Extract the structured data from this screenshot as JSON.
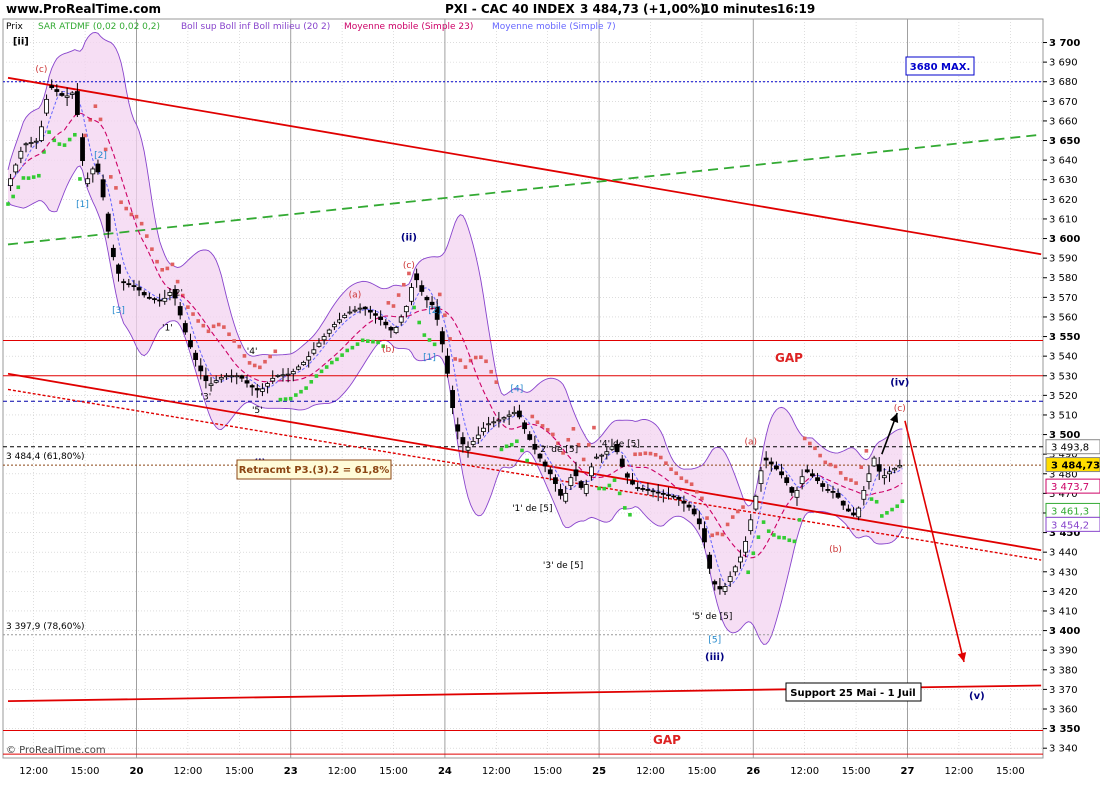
{
  "header": {
    "site": "www.ProRealTime.com",
    "instrument": "PXI - CAC 40 INDEX",
    "quote": "3 484,73 (+1,00%)",
    "interval": "10 minutes",
    "time": "16:19"
  },
  "legend": {
    "price": "Prix",
    "sar": "SAR ATDMF (0,02 0,02 0,2)",
    "boll": "Boll sup Boll inf Boll milieu (20 2)",
    "ma23": "Moyenne mobile (Simple 23)",
    "ma7": "Moyenne mobile (Simple 7)"
  },
  "colors": {
    "price": "#000000",
    "sar_up": "#33cc33",
    "sar_down": "#e06060",
    "boll": "#8844cc",
    "boll_fill": "#f3d3f0",
    "ma23": "#cc0066",
    "ma7": "#6666ff",
    "trend": "#e00000",
    "green_line": "#33aa33",
    "navy": "#000080",
    "grid": "#c8c8c8"
  },
  "footer": {
    "copyright": "© ProRealTime.com"
  },
  "chart_data": {
    "type": "candlestick",
    "ylim": [
      3335,
      3712
    ],
    "y_ticks": [
      "3 700",
      "3 690",
      "3 680",
      "3 670",
      "3 660",
      "3 650",
      "3 640",
      "3 630",
      "3 620",
      "3 610",
      "3 600",
      "3 590",
      "3 580",
      "3 570",
      "3 560",
      "3 550",
      "3 540",
      "3 530",
      "3 520",
      "3 510",
      "3 500",
      "3 490",
      "3 480",
      "3 470",
      "3 460",
      "3 450",
      "3 440",
      "3 430",
      "3 420",
      "3 410",
      "3 400",
      "3 390",
      "3 380",
      "3 370",
      "3 360",
      "3 350",
      "3 340"
    ],
    "y_tick_values": [
      3700,
      3690,
      3680,
      3670,
      3660,
      3650,
      3640,
      3630,
      3620,
      3610,
      3600,
      3590,
      3580,
      3570,
      3560,
      3550,
      3540,
      3530,
      3520,
      3510,
      3500,
      3490,
      3480,
      3470,
      3460,
      3450,
      3440,
      3430,
      3420,
      3410,
      3400,
      3390,
      3380,
      3370,
      3360,
      3350,
      3340
    ],
    "x_ticks": [
      {
        "label": "12:00",
        "t": 0.5,
        "bold": false
      },
      {
        "label": "15:00",
        "t": 1.5,
        "bold": false
      },
      {
        "label": "20",
        "t": 2.5,
        "bold": true
      },
      {
        "label": "12:00",
        "t": 3.5,
        "bold": false
      },
      {
        "label": "15:00",
        "t": 4.5,
        "bold": false
      },
      {
        "label": "23",
        "t": 5.5,
        "bold": true
      },
      {
        "label": "12:00",
        "t": 6.5,
        "bold": false
      },
      {
        "label": "15:00",
        "t": 7.5,
        "bold": false
      },
      {
        "label": "24",
        "t": 8.5,
        "bold": true
      },
      {
        "label": "12:00",
        "t": 9.5,
        "bold": false
      },
      {
        "label": "15:00",
        "t": 10.5,
        "bold": false
      },
      {
        "label": "25",
        "t": 11.5,
        "bold": true
      },
      {
        "label": "12:00",
        "t": 12.5,
        "bold": false
      },
      {
        "label": "15:00",
        "t": 13.5,
        "bold": false
      },
      {
        "label": "26",
        "t": 14.5,
        "bold": true
      },
      {
        "label": "12:00",
        "t": 15.5,
        "bold": false
      },
      {
        "label": "15:00",
        "t": 16.5,
        "bold": false
      },
      {
        "label": "27",
        "t": 17.5,
        "bold": true
      },
      {
        "label": "12:00",
        "t": 18.5,
        "bold": false
      },
      {
        "label": "15:00",
        "t": 19.5,
        "bold": false
      }
    ],
    "price_path": [
      [
        0.0,
        3627
      ],
      [
        0.3,
        3648
      ],
      [
        0.6,
        3650
      ],
      [
        0.8,
        3678
      ],
      [
        1.1,
        3672
      ],
      [
        1.3,
        3675
      ],
      [
        1.5,
        3628
      ],
      [
        1.7,
        3638
      ],
      [
        1.8,
        3630
      ],
      [
        2.0,
        3595
      ],
      [
        2.2,
        3578
      ],
      [
        2.5,
        3575
      ],
      [
        2.7,
        3570
      ],
      [
        3.0,
        3568
      ],
      [
        3.2,
        3574
      ],
      [
        3.5,
        3548
      ],
      [
        3.7,
        3535
      ],
      [
        3.9,
        3525
      ],
      [
        4.2,
        3530
      ],
      [
        4.5,
        3530
      ],
      [
        4.7,
        3525
      ],
      [
        4.9,
        3522
      ],
      [
        5.2,
        3530
      ],
      [
        5.5,
        3531
      ],
      [
        5.8,
        3538
      ],
      [
        6.0,
        3545
      ],
      [
        6.3,
        3555
      ],
      [
        6.6,
        3562
      ],
      [
        6.9,
        3565
      ],
      [
        7.2,
        3560
      ],
      [
        7.5,
        3552
      ],
      [
        7.8,
        3568
      ],
      [
        7.9,
        3582
      ],
      [
        8.1,
        3570
      ],
      [
        8.3,
        3565
      ],
      [
        8.5,
        3540
      ],
      [
        8.7,
        3505
      ],
      [
        8.9,
        3492
      ],
      [
        9.1,
        3498
      ],
      [
        9.3,
        3505
      ],
      [
        9.6,
        3508
      ],
      [
        9.9,
        3512
      ],
      [
        10.1,
        3500
      ],
      [
        10.3,
        3490
      ],
      [
        10.6,
        3478
      ],
      [
        10.8,
        3466
      ],
      [
        11.0,
        3482
      ],
      [
        11.2,
        3470
      ],
      [
        11.4,
        3488
      ],
      [
        11.6,
        3490
      ],
      [
        11.8,
        3495
      ],
      [
        12.0,
        3480
      ],
      [
        12.2,
        3473
      ],
      [
        12.4,
        3472
      ],
      [
        12.7,
        3470
      ],
      [
        13.0,
        3468
      ],
      [
        13.3,
        3462
      ],
      [
        13.5,
        3452
      ],
      [
        13.7,
        3425
      ],
      [
        13.9,
        3420
      ],
      [
        14.1,
        3430
      ],
      [
        14.3,
        3440
      ],
      [
        14.5,
        3462
      ],
      [
        14.7,
        3488
      ],
      [
        14.9,
        3484
      ],
      [
        15.1,
        3478
      ],
      [
        15.3,
        3468
      ],
      [
        15.5,
        3482
      ],
      [
        15.7,
        3478
      ],
      [
        15.9,
        3472
      ],
      [
        16.1,
        3470
      ],
      [
        16.3,
        3462
      ],
      [
        16.5,
        3458
      ],
      [
        16.7,
        3476
      ],
      [
        16.85,
        3488
      ],
      [
        17.0,
        3478
      ],
      [
        17.2,
        3482
      ],
      [
        17.4,
        3485
      ]
    ],
    "y_labels": [
      {
        "text": "3 493,8",
        "value": 3493.8,
        "fg": "#000000",
        "bg": "#ffffff"
      },
      {
        "text": "3 484,73",
        "value": 3484.7,
        "fg": "#000000",
        "bg": "#ffdd00"
      },
      {
        "text": "3 473,7",
        "value": 3473.7,
        "fg": "#cc0066",
        "bg": "#ffffff"
      },
      {
        "text": "3 461,3",
        "value": 3461.3,
        "fg": "#33aa33",
        "bg": "#ffffff"
      },
      {
        "text": "3 454,2",
        "value": 3454.2,
        "fg": "#8844cc",
        "bg": "#ffffff"
      }
    ],
    "levels": [
      {
        "name": "max",
        "value": 3680,
        "color": "#0000cc",
        "style": "dotted"
      },
      {
        "name": "fib618",
        "value": 3484.4,
        "color": "#8b4513",
        "style": "dotted"
      },
      {
        "name": "fib786",
        "value": 3397.9,
        "color": "#999999",
        "style": "dotted"
      },
      {
        "name": "gap-top-upper",
        "value": 3548,
        "color": "#e00000",
        "style": "solid"
      },
      {
        "name": "gap-top-lower",
        "value": 3530,
        "color": "#e00000",
        "style": "solid"
      },
      {
        "name": "ref-3517",
        "value": 3517,
        "color": "#0000aa",
        "style": "dashed"
      },
      {
        "name": "ref-3494",
        "value": 3493.8,
        "color": "#000000",
        "style": "dashed"
      },
      {
        "name": "gap-bottom-upper",
        "value": 3349,
        "color": "#e00000",
        "style": "solid"
      },
      {
        "name": "gap-bottom-lower",
        "value": 3337,
        "color": "#e00000",
        "style": "solid"
      }
    ],
    "trend_lines": [
      {
        "name": "upper-channel",
        "from": [
          0,
          3682
        ],
        "to": [
          20.1,
          3592
        ],
        "color": "#e00000",
        "dash": ""
      },
      {
        "name": "green-channel",
        "from": [
          0,
          3597
        ],
        "to": [
          20.1,
          3653
        ],
        "color": "#33aa33",
        "dash": "10 6"
      },
      {
        "name": "lower-channel",
        "from": [
          0,
          3531
        ],
        "to": [
          20.1,
          3441
        ],
        "color": "#e00000",
        "dash": ""
      },
      {
        "name": "lower-channel-dotted",
        "from": [
          0,
          3523
        ],
        "to": [
          20.1,
          3436
        ],
        "color": "#e00000",
        "dash": "3 2"
      },
      {
        "name": "support-line",
        "from": [
          0,
          3364
        ],
        "to": [
          20.1,
          3372
        ],
        "color": "#e00000",
        "dash": ""
      }
    ],
    "annotations": {
      "max_box": {
        "text": "3680 MAX.",
        "t": 18.3,
        "value": 3686
      },
      "fib618_label": "3 484,4 (61,80%)",
      "fib786_label": "3 397,9 (78,60%)",
      "retrace_box": "Retracmt P3.(3).2 = 61,8%",
      "gap_top": "GAP",
      "gap_bottom": "GAP",
      "support_box": "Support 25 Mai - 1 Juil",
      "waves": [
        {
          "text": "[ii]",
          "t": 0.25,
          "value": 3699,
          "color": "#000000",
          "bold": true
        },
        {
          "text": "(c)",
          "t": 0.65,
          "value": 3685,
          "color": "#cc3333",
          "bold": false
        },
        {
          "text": "[1]",
          "t": 1.45,
          "value": 3616,
          "color": "#2288cc",
          "bold": false
        },
        {
          "text": "[2]",
          "t": 1.8,
          "value": 3641,
          "color": "#2288cc",
          "bold": false
        },
        {
          "text": "[3]",
          "t": 2.15,
          "value": 3562,
          "color": "#2288cc",
          "bold": false
        },
        {
          "text": "'2'",
          "t": 3.3,
          "value": 3571,
          "color": "#000000",
          "bold": false
        },
        {
          "text": "'1'",
          "t": 3.1,
          "value": 3553,
          "color": "#000000",
          "bold": false
        },
        {
          "text": "'3'",
          "t": 3.85,
          "value": 3518,
          "color": "#000000",
          "bold": false
        },
        {
          "text": "'4'",
          "t": 4.75,
          "value": 3541,
          "color": "#000000",
          "bold": false
        },
        {
          "text": "'5'",
          "t": 4.85,
          "value": 3511,
          "color": "#000000",
          "bold": false
        },
        {
          "text": "(i)",
          "t": 4.9,
          "value": 3484,
          "color": "#000080",
          "bold": true
        },
        {
          "text": "(a)",
          "t": 6.75,
          "value": 3570,
          "color": "#cc3333",
          "bold": false
        },
        {
          "text": "(b)",
          "t": 7.4,
          "value": 3542,
          "color": "#cc3333",
          "bold": false
        },
        {
          "text": "(ii)",
          "t": 7.8,
          "value": 3599,
          "color": "#000080",
          "bold": true
        },
        {
          "text": "(c)",
          "t": 7.8,
          "value": 3585,
          "color": "#cc3333",
          "bold": false
        },
        {
          "text": "[1]",
          "t": 8.2,
          "value": 3538,
          "color": "#2288cc",
          "bold": false
        },
        {
          "text": "[2]",
          "t": 8.3,
          "value": 3562,
          "color": "#2288cc",
          "bold": false
        },
        {
          "text": "[4]",
          "t": 9.9,
          "value": 3522,
          "color": "#2288cc",
          "bold": false
        },
        {
          "text": "'2' de [5]",
          "t": 10.7,
          "value": 3491,
          "color": "#000000",
          "bold": false
        },
        {
          "text": "'1' de [5]",
          "t": 10.2,
          "value": 3461,
          "color": "#000000",
          "bold": false
        },
        {
          "text": "'3' de [5]",
          "t": 10.8,
          "value": 3432,
          "color": "#000000",
          "bold": false
        },
        {
          "text": "'4' de [5]",
          "t": 11.9,
          "value": 3494,
          "color": "#000000",
          "bold": false
        },
        {
          "text": "'5' de [5]",
          "t": 13.7,
          "value": 3406,
          "color": "#000000",
          "bold": false
        },
        {
          "text": "[5]",
          "t": 13.75,
          "value": 3394,
          "color": "#2288cc",
          "bold": false
        },
        {
          "text": "(iii)",
          "t": 13.75,
          "value": 3385,
          "color": "#000080",
          "bold": true
        },
        {
          "text": "(a)",
          "t": 14.45,
          "value": 3495,
          "color": "#cc3333",
          "bold": false
        },
        {
          "text": "(b)",
          "t": 16.1,
          "value": 3440,
          "color": "#cc3333",
          "bold": false
        },
        {
          "text": "(iv)",
          "t": 17.35,
          "value": 3525,
          "color": "#000080",
          "bold": true
        },
        {
          "text": "(c)",
          "t": 17.35,
          "value": 3512,
          "color": "#cc3333",
          "bold": false
        },
        {
          "text": "(v)",
          "t": 18.85,
          "value": 3365,
          "color": "#000080",
          "bold": true
        }
      ],
      "arrows": [
        {
          "name": "arrow-up",
          "from": [
            17.0,
            3490
          ],
          "to": [
            17.3,
            3511
          ],
          "color": "#000000"
        },
        {
          "name": "arrow-down",
          "from": [
            17.45,
            3507
          ],
          "to": [
            18.6,
            3384
          ],
          "color": "#e00000"
        }
      ]
    }
  }
}
